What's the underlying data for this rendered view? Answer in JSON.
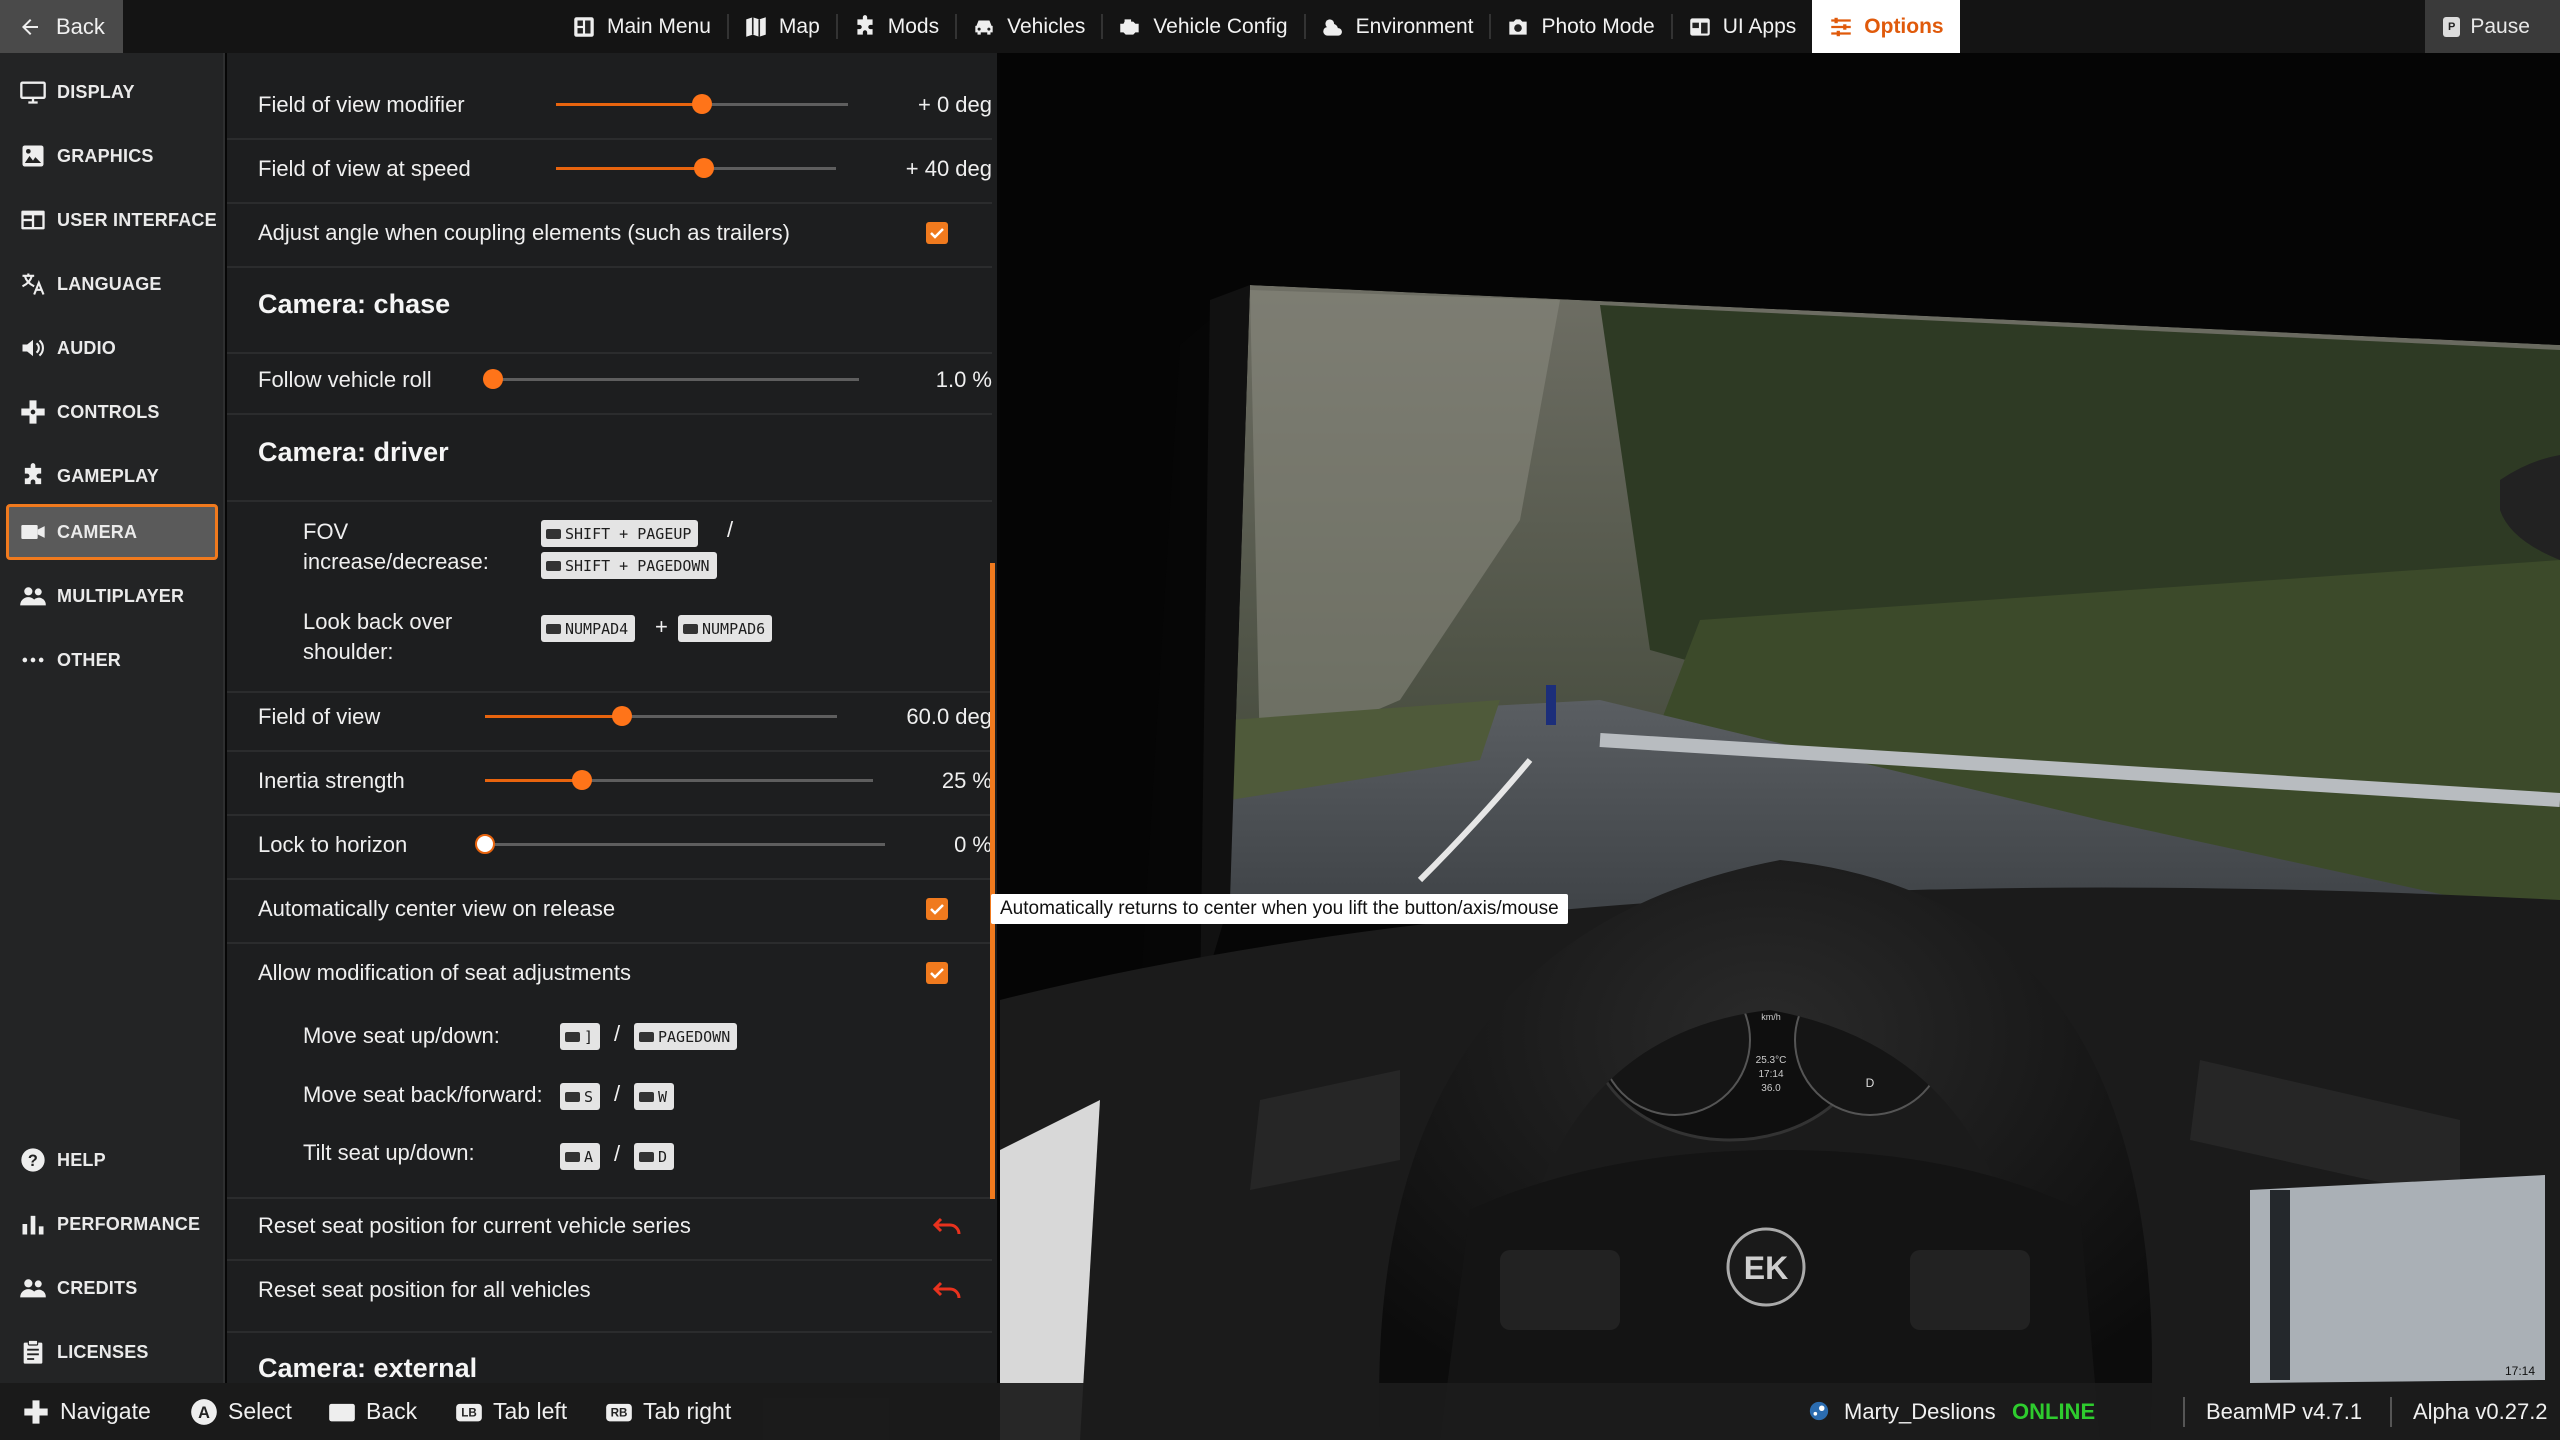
{
  "colors": {
    "accent": "#f07a1e",
    "online": "#2ecc2e",
    "panel_bg": "#1e1f20",
    "sidebar_bg": "#232425"
  },
  "topbar": {
    "back_label": "Back",
    "nav": [
      {
        "label": "Main Menu",
        "icon": "main-menu-icon"
      },
      {
        "label": "Map",
        "icon": "map-icon"
      },
      {
        "label": "Mods",
        "icon": "puzzle-icon"
      },
      {
        "label": "Vehicles",
        "icon": "car-icon"
      },
      {
        "label": "Vehicle Config",
        "icon": "engine-icon"
      },
      {
        "label": "Environment",
        "icon": "weather-icon"
      },
      {
        "label": "Photo Mode",
        "icon": "camera-icon"
      },
      {
        "label": "UI Apps",
        "icon": "ui-apps-icon"
      },
      {
        "label": "Options",
        "icon": "sliders-icon",
        "active": true
      }
    ],
    "pause_key": "P",
    "pause_label": "Pause"
  },
  "sidebar": {
    "items": [
      {
        "label": "DISPLAY",
        "icon": "monitor-icon"
      },
      {
        "label": "GRAPHICS",
        "icon": "image-icon"
      },
      {
        "label": "USER INTERFACE",
        "icon": "ui-icon"
      },
      {
        "label": "LANGUAGE",
        "icon": "translate-icon"
      },
      {
        "label": "AUDIO",
        "icon": "speaker-icon"
      },
      {
        "label": "CONTROLS",
        "icon": "dpad-icon"
      },
      {
        "label": "GAMEPLAY",
        "icon": "puzzle-icon"
      },
      {
        "label": "CAMERA",
        "icon": "video-camera-icon",
        "active": true
      },
      {
        "label": "MULTIPLAYER",
        "icon": "people-icon"
      },
      {
        "label": "OTHER",
        "icon": "dots-icon"
      }
    ],
    "bottom_items": [
      {
        "label": "HELP",
        "icon": "help-icon"
      },
      {
        "label": "PERFORMANCE",
        "icon": "bars-icon"
      },
      {
        "label": "CREDITS",
        "icon": "people-icon"
      },
      {
        "label": "LICENSES",
        "icon": "clipboard-icon"
      }
    ]
  },
  "settings": {
    "fov_modifier": {
      "label": "Field of view modifier",
      "value_text": "+ 0 deg",
      "fraction": 0.5
    },
    "fov_speed": {
      "label": "Field of view at speed",
      "value_text": "+ 40 deg",
      "fraction": 0.53
    },
    "adjust_angle": {
      "label": "Adjust angle when coupling elements (such as trailers)",
      "checked": true
    },
    "chase_title": "Camera: chase",
    "follow_roll": {
      "label": "Follow vehicle roll",
      "value_text": "1.0 %",
      "fraction": 0.01
    },
    "driver_title": "Camera: driver",
    "fov_keys": {
      "label": "FOV increase/decrease:",
      "key1": "SHIFT + PAGEUP",
      "sep": "/",
      "key2": "SHIFT + PAGEDOWN"
    },
    "look_back": {
      "label": "Look back over shoulder:",
      "key1": "NUMPAD4",
      "sep": "+",
      "key2": "NUMPAD6"
    },
    "fov": {
      "label": "Field of view",
      "value_text": "60.0 deg",
      "fraction": 0.39
    },
    "inertia": {
      "label": "Inertia strength",
      "value_text": "25 %",
      "fraction": 0.25
    },
    "lock_horizon": {
      "label": "Lock to horizon",
      "value_text": "0 %",
      "fraction": 0.0
    },
    "auto_center": {
      "label": "Automatically center view on release",
      "checked": true
    },
    "seat_mod": {
      "label": "Allow modification of seat adjustments",
      "checked": true
    },
    "seat_updown": {
      "label": "Move seat up/down:",
      "key1": "]",
      "sep": "/",
      "key2": "PAGEDOWN"
    },
    "seat_backfwd": {
      "label": "Move seat back/forward:",
      "key1": "S",
      "sep": "/",
      "key2": "W"
    },
    "tilt": {
      "label": "Tilt seat up/down:",
      "key1": "A",
      "sep": "/",
      "key2": "D"
    },
    "reset_current": {
      "label": "Reset seat position for current vehicle series"
    },
    "reset_all": {
      "label": "Reset seat position for all vehicles"
    },
    "external_title": "Camera: external"
  },
  "tooltip": "Automatically returns to center when you lift the button/axis/mouse",
  "bottombar": {
    "hints": [
      {
        "label": "Navigate",
        "icon": "dpad-icon"
      },
      {
        "label": "Select",
        "icon": "a-button-icon"
      },
      {
        "label": "Back",
        "icon": "back-key-icon"
      },
      {
        "label": "Tab left",
        "icon": "lb-button-icon"
      },
      {
        "label": "Tab right",
        "icon": "rb-button-icon"
      }
    ],
    "username": "Marty_Deslions",
    "status": "ONLINE",
    "beammp_version": "BeamMP v4.7.1",
    "game_version": "Alpha v0.27.2"
  },
  "scene": {
    "speed": "0",
    "speed_unit": "km/h",
    "temp": "25.3°C",
    "clock": "17:14",
    "odometer": "36.0",
    "gear": "D",
    "logo": "EK",
    "screen_clock": "17:14"
  }
}
